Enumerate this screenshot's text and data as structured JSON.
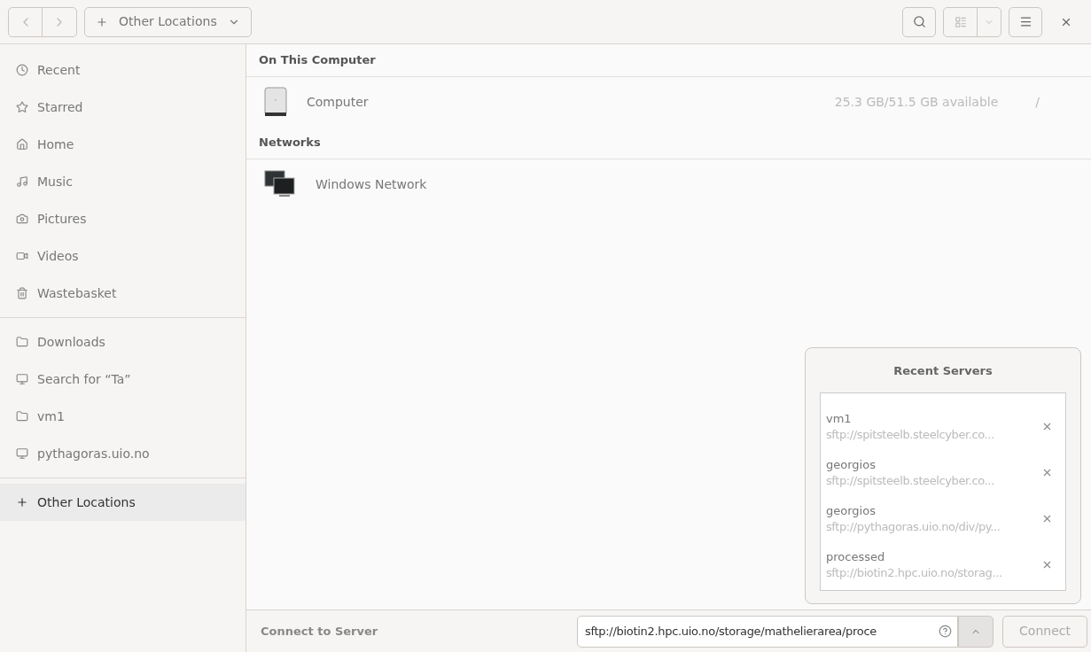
{
  "header": {
    "location": "Other Locations"
  },
  "sidebar": {
    "sections": [
      [
        {
          "label": "Recent",
          "selected": false
        },
        {
          "label": "Starred",
          "selected": false
        },
        {
          "label": "Home",
          "selected": false
        },
        {
          "label": "Music",
          "selected": false
        },
        {
          "label": "Pictures",
          "selected": false
        },
        {
          "label": "Videos",
          "selected": false
        },
        {
          "label": "Wastebasket",
          "selected": false
        }
      ],
      [
        {
          "label": "Downloads",
          "selected": false
        },
        {
          "label": "Search for “Ta”",
          "selected": false
        },
        {
          "label": "vm1",
          "selected": false
        },
        {
          "label": "pythagoras.uio.no",
          "selected": false
        }
      ],
      [
        {
          "label": "Other Locations",
          "selected": true
        }
      ]
    ]
  },
  "groups": [
    {
      "title": "On This Computer",
      "items": [
        {
          "kind": "drive",
          "name": "Computer",
          "info": "25.3 GB/51.5 GB available",
          "path": "/"
        }
      ]
    },
    {
      "title": "Networks",
      "items": [
        {
          "kind": "network",
          "name": "Windows Network"
        }
      ]
    }
  ],
  "recent_servers": {
    "title": "Recent Servers",
    "items": [
      {
        "name": "vm1",
        "uri": "sftp://spitsteelb.steelcyber.co..."
      },
      {
        "name": "georgios",
        "uri": "sftp://spitsteelb.steelcyber.co..."
      },
      {
        "name": "georgios",
        "uri": "sftp://pythagoras.uio.no/div/py..."
      },
      {
        "name": "processed",
        "uri": "sftp://biotin2.hpc.uio.no/storag..."
      }
    ]
  },
  "connect_bar": {
    "label": "Connect to Server",
    "value": "sftp://biotin2.hpc.uio.no/storage/mathelierarea/proce",
    "button": "Connect"
  }
}
